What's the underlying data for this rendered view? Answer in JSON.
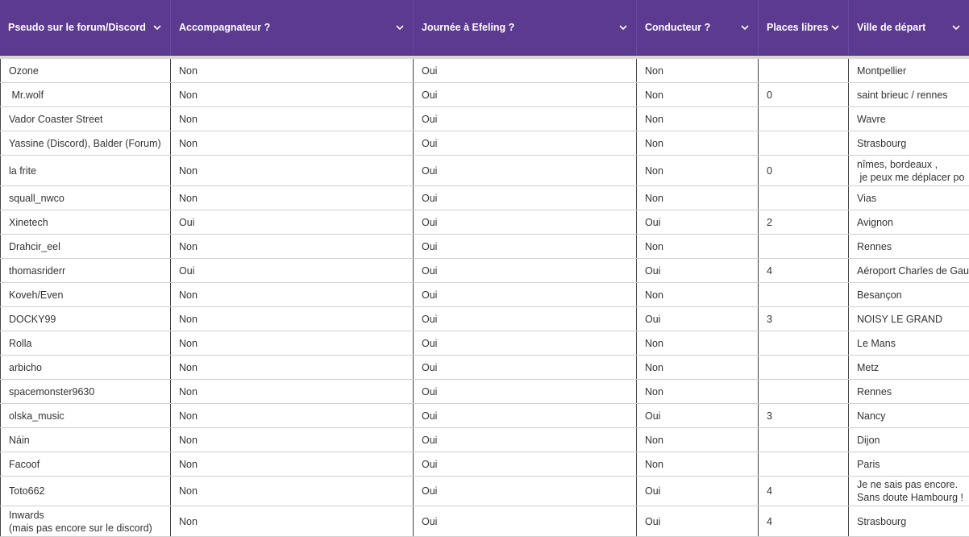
{
  "columns": [
    "Pseudo sur le forum/Discord",
    "Accompagnateur ?",
    "Journée à Efeling ?",
    "Conducteur ?",
    "Places libres",
    "Ville de départ"
  ],
  "rows": [
    [
      "Ozone",
      "Non",
      "Oui",
      "Non",
      "",
      "Montpellier"
    ],
    [
      " Mr.wolf",
      "Non",
      "Oui",
      "Non",
      "0",
      "saint brieuc / rennes"
    ],
    [
      "Vador Coaster Street",
      "Non",
      "Oui",
      "Non",
      "",
      "Wavre"
    ],
    [
      "Yassine (Discord), Balder (Forum)",
      "Non",
      "Oui",
      "Non",
      "",
      "Strasbourg"
    ],
    [
      "la frite",
      "Non",
      "Oui",
      "Non",
      "0",
      "nîmes, bordeaux ,\n je peux me déplacer po"
    ],
    [
      "squall_nwco",
      "Non",
      "Oui",
      "Non",
      "",
      "Vias"
    ],
    [
      "Xinetech",
      "Oui",
      "Oui",
      "Oui",
      "2",
      "Avignon"
    ],
    [
      "Drahcir_eel",
      "Non",
      "Oui",
      "Non",
      "",
      "Rennes"
    ],
    [
      "thomasriderr",
      "Oui",
      "Oui",
      "Oui",
      "4",
      "Aéroport Charles de Gau"
    ],
    [
      "Koveh/Even",
      "Non",
      "Oui",
      "Non",
      "",
      "Besançon"
    ],
    [
      "DOCKY99",
      "Non",
      "Oui",
      "Oui",
      "3",
      "NOISY LE GRAND"
    ],
    [
      "Rolla",
      "Non",
      "Oui",
      "Non",
      "",
      "Le Mans"
    ],
    [
      "arbicho",
      "Non",
      "Oui",
      "Non",
      "",
      "Metz"
    ],
    [
      "spacemonster9630",
      "Non",
      "Oui",
      "Non",
      "",
      "Rennes"
    ],
    [
      "olska_music",
      "Non",
      "Oui",
      "Oui",
      "3",
      "Nancy"
    ],
    [
      "Náin",
      "Non",
      "Oui",
      "Non",
      "",
      "Dijon"
    ],
    [
      "Facoof",
      "Non",
      "Oui",
      "Non",
      "",
      "Paris"
    ],
    [
      "Toto662",
      "Non",
      "Oui",
      "Oui",
      "4",
      "Je ne sais pas encore.\nSans doute Hambourg !"
    ],
    [
      "Inwards\n(mais pas encore sur le discord)",
      "Non",
      "Oui",
      "Oui",
      "4",
      "Strasbourg"
    ]
  ],
  "icons": {
    "sort": "chevron-down-icon"
  },
  "colors": {
    "header_bg": "#5b3a8f",
    "header_text": "#ffffff",
    "grid": "#444444"
  }
}
